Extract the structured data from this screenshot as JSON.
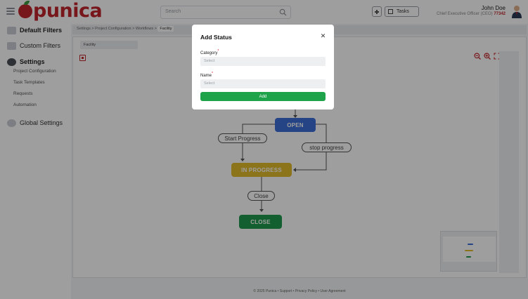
{
  "app": {
    "brand": "punica",
    "search_placeholder": "Search",
    "tasks_label": "Tasks",
    "user": {
      "name": "John Doe",
      "role": "Chief Executive Officer (CEO)",
      "id": "77342"
    }
  },
  "sidebar": {
    "default_filters": "Default Filters",
    "custom_filters": "Custom Filters",
    "settings": "Settings",
    "settings_items": [
      "Project Configuration",
      "Task Templates",
      "Requests",
      "Automation"
    ],
    "global_settings": "Global Settings"
  },
  "breadcrumb": {
    "items": [
      "Settings",
      "Project Configuration",
      "Workflows"
    ],
    "current": "Facility",
    "separator": ">"
  },
  "main": {
    "tab": "Facility"
  },
  "workflow": {
    "statuses": [
      {
        "label": "OPEN",
        "color": "#3b6fd8"
      },
      {
        "label": "IN PROGRESS",
        "color": "#e2bb2c"
      },
      {
        "label": "CLOSE",
        "color": "#1f9a4c"
      }
    ],
    "transitions": [
      "Start Progress",
      "stop progress",
      "Close"
    ]
  },
  "footer": {
    "copyright": "© 2025 Punica",
    "links": [
      "Support",
      "Privacy Policy",
      "User Agreement"
    ]
  },
  "modal": {
    "title": "Add Status",
    "category_label": "Category",
    "category_placeholder": "Select",
    "name_label": "Name",
    "name_placeholder": "Select",
    "submit_label": "Add",
    "required_mark": "*"
  },
  "colors": {
    "brand": "#c0262d",
    "submit": "#1fa34a"
  }
}
